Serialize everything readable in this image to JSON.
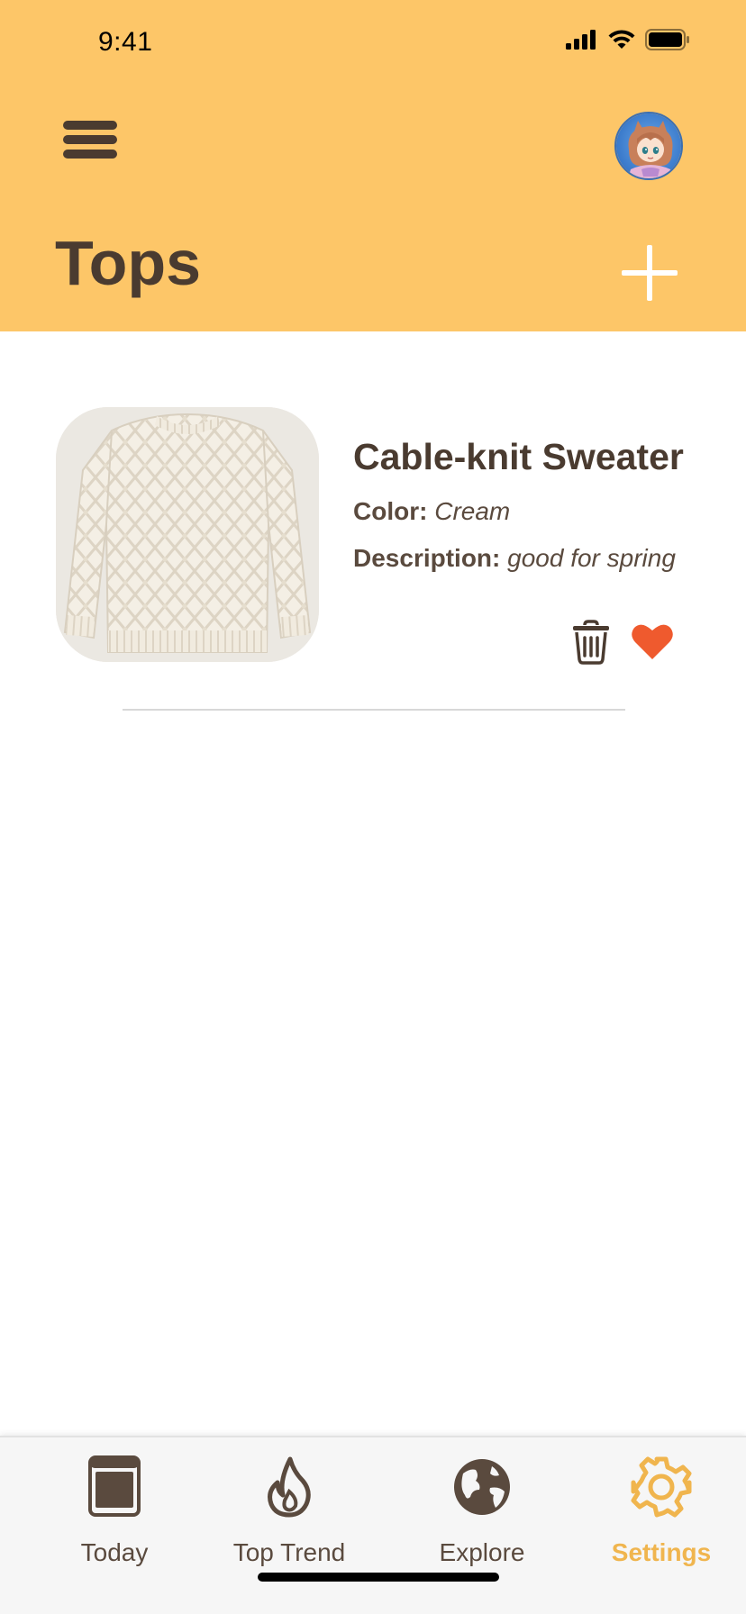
{
  "status_bar": {
    "time": "9:41"
  },
  "header": {
    "title": "Tops"
  },
  "items": [
    {
      "name": "Cable-knit Sweater",
      "color_label": "Color:",
      "color_value": "Cream",
      "description_label": "Description:",
      "description_value": "good for spring",
      "favorite": true
    }
  ],
  "tabs": [
    {
      "label": "Today",
      "icon": "tablet-icon",
      "active": false
    },
    {
      "label": "Top Trend",
      "icon": "flame-icon",
      "active": false
    },
    {
      "label": "Explore",
      "icon": "globe-icon",
      "active": false
    },
    {
      "label": "Settings",
      "icon": "gear-icon",
      "active": true
    }
  ],
  "colors": {
    "header_bg": "#fdc668",
    "text_primary": "#4a3b30",
    "accent_active": "#f0b54e",
    "heart": "#ef5a2e"
  }
}
